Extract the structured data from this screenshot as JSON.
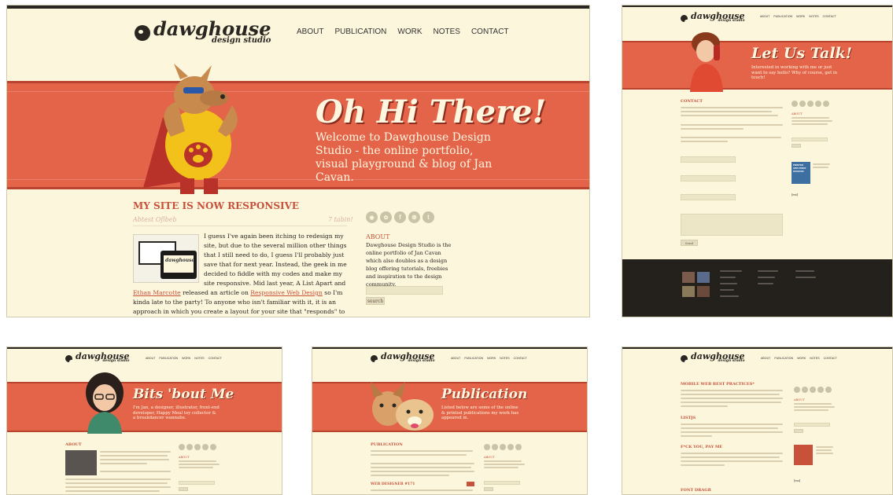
{
  "brand": {
    "name": "dawghouse",
    "tagline": "design studio"
  },
  "nav": [
    "ABOUT",
    "PUBLICATION",
    "WORK",
    "NOTES",
    "CONTACT"
  ],
  "colors": {
    "cream": "#fbf6dc",
    "banner": "#e4644a",
    "accent": "#c8513a",
    "dark": "#24211d"
  },
  "home": {
    "banner_title": "Oh Hi There!",
    "banner_text": "Welcome to Dawghouse Design Studio - the online portfolio, visual playground & blog of Jan Cavan.",
    "post_title": "MY SITE IS NOW RESPONSIVE",
    "post_meta_left": "Abtest Oflbeb",
    "post_meta_right": "7 tabin!",
    "post_intro": "I guess I've again been itching to redesign my site, but due to the several million other things that I still need to do, I guess I'll probably just save that for next year. Instead, the geek in me decided to fiddle with my codes and make my site responsive. Mid last year, A List Apart and",
    "link_ethan": "Ethan Marcotte",
    "post_mid": "released an article on",
    "link_rwd": "Responsive Web Design",
    "post_rest": "so I'm kinda late to the party! To anyone who isn't familiar with it, it is an approach in which you create a layout for your site that \"responds\" to the width of the device you're using. That means you no longer need create a separate mobile version of your site that needs to adapt to the screens",
    "about_title": "ABOUT",
    "about_text": "Dawghouse Design Studio is the online portfolio of Jan Cavan which also doubles as a design blog offering tutorials, freebies and inspiration to the design community.",
    "search_label": "search",
    "thumb_wm": "dawghouse",
    "thumb_sub": "design studio"
  },
  "contact": {
    "banner_title": "Let Us Talk!",
    "banner_text": "Interested in working with me or just want to say hello? Why of course, get in touch!",
    "section_title": "CONTACT",
    "about_title": "ABOUT",
    "submit": "Send",
    "ad_text": "PRINTED 1855 PRINT GRAPHIC",
    "follow": "[rss]"
  },
  "bits": {
    "banner_title": "Bits 'bout Me",
    "banner_text": "I'm Jan, a designer, illustrator, front-end developer, Happy Meal toy collector & a breakdancer wannabe.",
    "section_title": "ABOUT",
    "about_title": "ABOUT"
  },
  "publication": {
    "banner_title": "Publication",
    "banner_text": "Listed below are some of the online & printed publications my work has appeared in.",
    "section_title": "PUBLICATION",
    "sub_title": "WEB DESIGNER #171",
    "about_title": "ABOUT"
  },
  "notes": {
    "title1": "MOBILE WEB BEST PRACTICES*",
    "title2": "LISTJS",
    "title3": "F*CK YOU, PAY ME",
    "title4": "FONT DRAGR",
    "about_title": "ABOUT",
    "follow": "[rss]"
  }
}
